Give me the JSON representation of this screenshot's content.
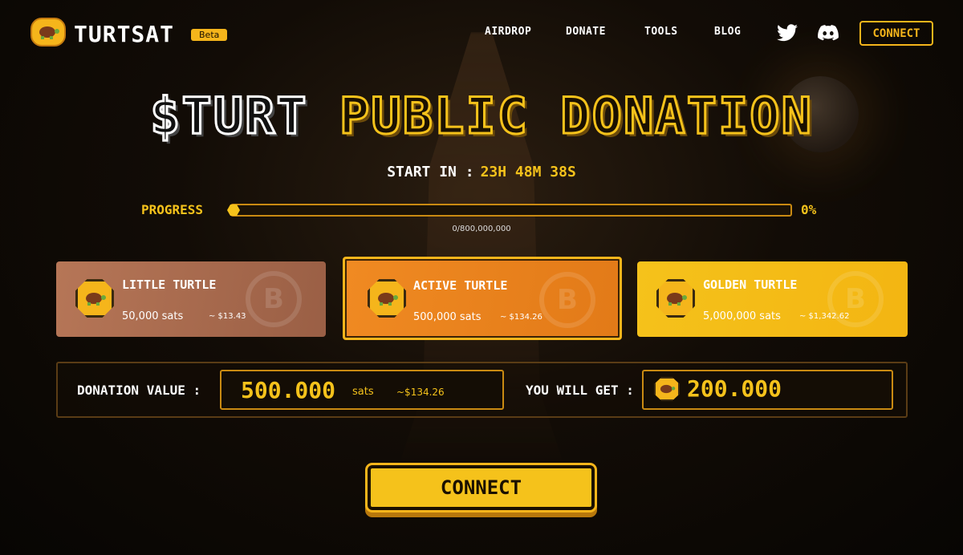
{
  "nav": {
    "brand": "TURTSAT",
    "beta": "Beta",
    "links": [
      "AIRDROP",
      "DONATE",
      "TOOLS",
      "BLOG"
    ],
    "connect": "CONNECT"
  },
  "hero": {
    "title_white": "$TURT",
    "title_yellow": "PUBLIC DONATION",
    "start_label": "START IN :",
    "countdown": "23H 48M 38S"
  },
  "progress": {
    "label": "PROGRESS",
    "percent_text": "0%",
    "fill_fraction": 0.0,
    "count": "0/800,000,000"
  },
  "tiers": [
    {
      "name": "LITTLE TURTLE",
      "sats": "50,000 sats",
      "usd": "~ $13.43"
    },
    {
      "name": "ACTIVE TURTLE",
      "sats": "500,000 sats",
      "usd": "~ $134.26"
    },
    {
      "name": "GOLDEN TURTLE",
      "sats": "5,000,000 sats",
      "usd": "~ $1,342.62"
    }
  ],
  "donation": {
    "label": "DONATION VALUE :",
    "value": "500.000",
    "unit": "sats",
    "usd": "~$134.26",
    "get_label": "YOU WILL GET :",
    "get_value": "200.000"
  },
  "cta": {
    "connect": "CONNECT"
  },
  "colors": {
    "accent": "#f5c21b",
    "bronze": "#b67657",
    "orange": "#f08a22",
    "gold": "#f5c21b"
  }
}
